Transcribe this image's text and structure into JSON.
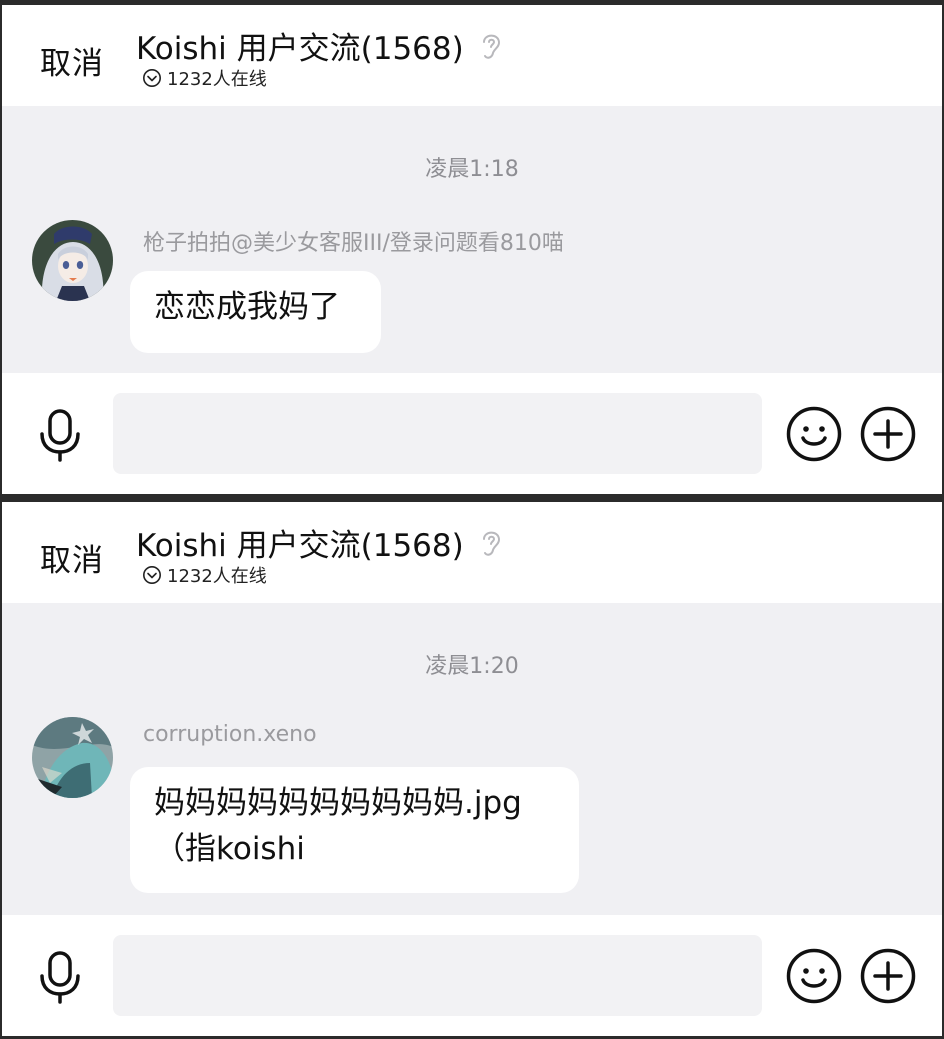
{
  "panels": [
    {
      "header": {
        "cancel_label": "取消",
        "title": "Koishi 用户交流(1568)",
        "online": "1232人在线"
      },
      "timestamp": "凌晨1:18",
      "message": {
        "sender": "枪子拍拍@美少女客服III/登录问题看810喵",
        "lines": [
          "恋恋成我妈了"
        ]
      },
      "input": {
        "placeholder": ""
      }
    },
    {
      "header": {
        "cancel_label": "取消",
        "title": "Koishi 用户交流(1568)",
        "online": "1232人在线"
      },
      "timestamp": "凌晨1:20",
      "message": {
        "sender": "corruption.xeno",
        "lines": [
          "妈妈妈妈妈妈妈妈妈妈.jpg",
          "（指koishi"
        ]
      },
      "input": {
        "placeholder": ""
      }
    }
  ],
  "icons": {
    "ear": "ear-icon",
    "online": "chevron-circle-icon",
    "mic": "microphone-icon",
    "emoji": "smiley-icon",
    "plus": "plus-circle-icon"
  },
  "colors": {
    "chat_background": "#f0f0f3",
    "bubble": "#ffffff",
    "timestamp_text": "#8e8e93",
    "sender_text": "#9a9a9e"
  }
}
